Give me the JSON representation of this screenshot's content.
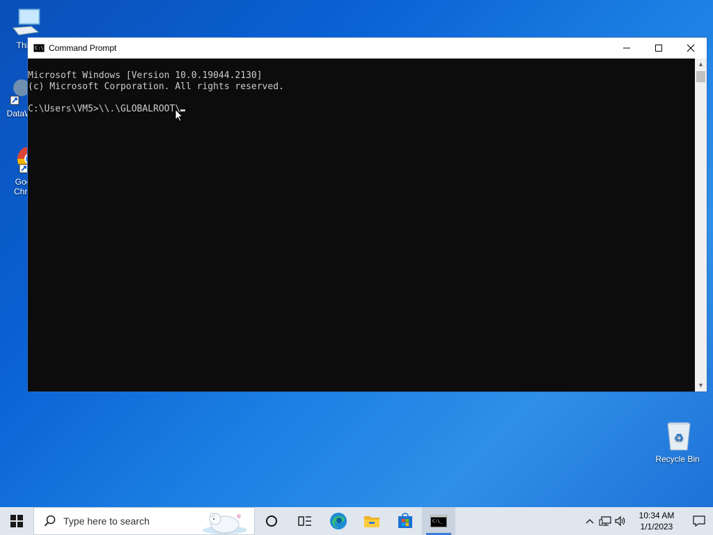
{
  "desktop": {
    "icons": [
      {
        "label": "This",
        "icon": "computer-icon"
      },
      {
        "label": "DataW",
        "icon": "app-shortcut-icon"
      },
      {
        "label": "Goo\nChro",
        "icon": "chrome-icon"
      },
      {
        "label": "Recycle Bin",
        "icon": "recycle-bin-icon"
      }
    ]
  },
  "window": {
    "title": "Command Prompt",
    "controls": {
      "minimize": "—",
      "maximize": "☐",
      "close": "✕"
    },
    "console_lines": [
      "Microsoft Windows [Version 10.0.19044.2130]",
      "(c) Microsoft Corporation. All rights reserved.",
      "",
      "C:\\Users\\VM5>\\\\.\\GLOBALROOT\\"
    ]
  },
  "taskbar": {
    "search_placeholder": "Type here to search",
    "clock_time": "10:34 AM",
    "clock_date": "1/1/2023"
  },
  "colors": {
    "console_bg": "#0c0c0c",
    "console_fg": "#cccccc",
    "taskbar_bg": "#dfe6ee",
    "accent": "#3a7bd5"
  }
}
